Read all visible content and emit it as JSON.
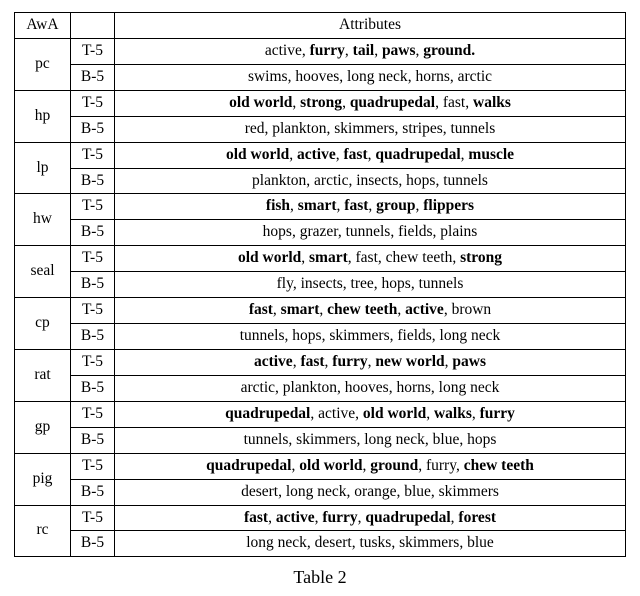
{
  "header": {
    "c1": "AwA",
    "c2": "",
    "c3": "Attributes"
  },
  "row_labels": {
    "top": "T-5",
    "bottom": "B-5"
  },
  "caption": "Table 2",
  "rows": [
    {
      "label": "pc",
      "top": [
        [
          "active",
          false
        ],
        [
          "furry",
          true
        ],
        [
          "tail",
          true
        ],
        [
          "paws",
          true
        ],
        [
          "ground.",
          true
        ]
      ],
      "bottom": [
        [
          "swims",
          false
        ],
        [
          "hooves",
          false
        ],
        [
          "long neck",
          false
        ],
        [
          "horns",
          false
        ],
        [
          "arctic",
          false
        ]
      ]
    },
    {
      "label": "hp",
      "top": [
        [
          "old world",
          true
        ],
        [
          "strong",
          true
        ],
        [
          "quadrupedal",
          true
        ],
        [
          "fast",
          false
        ],
        [
          "walks",
          true
        ]
      ],
      "bottom": [
        [
          "red",
          false
        ],
        [
          "plankton",
          false
        ],
        [
          "skimmers",
          false
        ],
        [
          "stripes",
          false
        ],
        [
          "tunnels",
          false
        ]
      ]
    },
    {
      "label": "lp",
      "top": [
        [
          "old world",
          true
        ],
        [
          "active",
          true
        ],
        [
          "fast",
          true
        ],
        [
          "quadrupedal",
          true
        ],
        [
          "muscle",
          true
        ]
      ],
      "bottom": [
        [
          "plankton",
          false
        ],
        [
          "arctic",
          false
        ],
        [
          "insects",
          false
        ],
        [
          "hops",
          false
        ],
        [
          "tunnels",
          false
        ]
      ]
    },
    {
      "label": "hw",
      "top": [
        [
          "fish",
          true
        ],
        [
          "smart",
          true
        ],
        [
          "fast",
          true
        ],
        [
          "group",
          true
        ],
        [
          "flippers",
          true
        ]
      ],
      "bottom": [
        [
          "hops",
          false
        ],
        [
          "grazer",
          false
        ],
        [
          "tunnels",
          false
        ],
        [
          "fields",
          false
        ],
        [
          "plains",
          false
        ]
      ]
    },
    {
      "label": "seal",
      "top": [
        [
          "old world",
          true
        ],
        [
          "smart",
          true
        ],
        [
          "fast",
          false
        ],
        [
          "chew teeth",
          false
        ],
        [
          "strong",
          true
        ]
      ],
      "bottom": [
        [
          "fly",
          false
        ],
        [
          "insects",
          false
        ],
        [
          "tree",
          false
        ],
        [
          "hops",
          false
        ],
        [
          "tunnels",
          false
        ]
      ]
    },
    {
      "label": "cp",
      "top": [
        [
          "fast",
          true
        ],
        [
          "smart",
          true
        ],
        [
          "chew teeth",
          true
        ],
        [
          "active",
          true
        ],
        [
          "brown",
          false
        ]
      ],
      "bottom": [
        [
          "tunnels",
          false
        ],
        [
          "hops",
          false
        ],
        [
          "skimmers",
          false
        ],
        [
          "fields",
          false
        ],
        [
          "long neck",
          false
        ]
      ]
    },
    {
      "label": "rat",
      "top": [
        [
          "active",
          true
        ],
        [
          "fast",
          true
        ],
        [
          "furry",
          true
        ],
        [
          "new world",
          true
        ],
        [
          "paws",
          true
        ]
      ],
      "bottom": [
        [
          "arctic",
          false
        ],
        [
          "plankton",
          false
        ],
        [
          "hooves",
          false
        ],
        [
          "horns",
          false
        ],
        [
          "long neck",
          false
        ]
      ]
    },
    {
      "label": "gp",
      "top": [
        [
          "quadrupedal",
          true
        ],
        [
          "active",
          false
        ],
        [
          "old world",
          true
        ],
        [
          "walks",
          true
        ],
        [
          "furry",
          true
        ]
      ],
      "bottom": [
        [
          "tunnels",
          false
        ],
        [
          "skimmers",
          false
        ],
        [
          "long neck",
          false
        ],
        [
          "blue",
          false
        ],
        [
          "hops",
          false
        ]
      ]
    },
    {
      "label": "pig",
      "top": [
        [
          "quadrupedal",
          true
        ],
        [
          "old world",
          true
        ],
        [
          "ground",
          true
        ],
        [
          "furry",
          false
        ],
        [
          "chew teeth",
          true
        ]
      ],
      "bottom": [
        [
          "desert",
          false
        ],
        [
          "long neck",
          false
        ],
        [
          "orange",
          false
        ],
        [
          "blue",
          false
        ],
        [
          "skimmers",
          false
        ]
      ]
    },
    {
      "label": "rc",
      "top": [
        [
          "fast",
          true
        ],
        [
          "active",
          true
        ],
        [
          "furry",
          true
        ],
        [
          "quadrupedal",
          true
        ],
        [
          "forest",
          true
        ]
      ],
      "bottom": [
        [
          "long neck",
          false
        ],
        [
          "desert",
          false
        ],
        [
          "tusks",
          false
        ],
        [
          "skimmers",
          false
        ],
        [
          "blue",
          false
        ]
      ]
    }
  ]
}
